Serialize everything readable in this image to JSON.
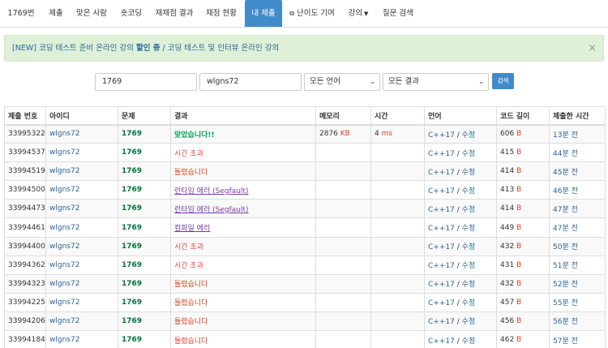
{
  "nav": {
    "tabs": [
      {
        "label": "1769번",
        "name": "tab-problem"
      },
      {
        "label": "제출",
        "name": "tab-submit"
      },
      {
        "label": "맞은 사람",
        "name": "tab-correct-users"
      },
      {
        "label": "숏코딩",
        "name": "tab-short-coding"
      },
      {
        "label": "재채점 결과",
        "name": "tab-rejudge-result"
      },
      {
        "label": "채점 현황",
        "name": "tab-status"
      },
      {
        "label": "내 제출",
        "name": "tab-my-submissions",
        "active": true
      },
      {
        "label": "난이도 기여",
        "name": "tab-difficulty"
      },
      {
        "label": "강의",
        "name": "tab-lectures"
      },
      {
        "label": "질문 검색",
        "name": "tab-question-search"
      }
    ]
  },
  "alert": {
    "new_tag": "[NEW]",
    "part1": "코딩 테스트 준비 온라인 강의",
    "bold1": "할인 중",
    "sep": "/",
    "part2": "코딩 테스트 및 인터뷰 온라인 강의",
    "close": "×"
  },
  "filters": {
    "problem_id": "1769",
    "user_id": "wlgns72",
    "language": "모든 언어",
    "result": "모든 결과",
    "search_button": "검색"
  },
  "table": {
    "headers": [
      "제출 번호",
      "아이디",
      "문제",
      "결과",
      "메모리",
      "시간",
      "언어",
      "코드 길이",
      "제출한 시간"
    ],
    "rows": [
      {
        "id": "33995322",
        "user": "wlgns72",
        "problem": "1769",
        "result": "맞았습니다!!",
        "type": "ok",
        "memory": "2876",
        "memory_unit": "KB",
        "time": "4",
        "time_unit": "ms",
        "lang": "C++17",
        "edit": "수정",
        "length": "606",
        "length_unit": "B",
        "submitted": "13분 전"
      },
      {
        "id": "33994537",
        "user": "wlgns72",
        "problem": "1769",
        "result": "시간 초과",
        "type": "tle",
        "memory": "",
        "memory_unit": "",
        "time": "",
        "time_unit": "",
        "lang": "C++17",
        "edit": "수정",
        "length": "415",
        "length_unit": "B",
        "submitted": "44분 전"
      },
      {
        "id": "33994519",
        "user": "wlgns72",
        "problem": "1769",
        "result": "틀렸습니다",
        "type": "wrong",
        "memory": "",
        "memory_unit": "",
        "time": "",
        "time_unit": "",
        "lang": "C++17",
        "edit": "수정",
        "length": "414",
        "length_unit": "B",
        "submitted": "45분 전"
      },
      {
        "id": "33994500",
        "user": "wlgns72",
        "problem": "1769",
        "result": "런타임 에러 (Segfault)",
        "type": "rte",
        "memory": "",
        "memory_unit": "",
        "time": "",
        "time_unit": "",
        "lang": "C++17",
        "edit": "수정",
        "length": "413",
        "length_unit": "B",
        "submitted": "46분 전"
      },
      {
        "id": "33994473",
        "user": "wlgns72",
        "problem": "1769",
        "result": "런타임 에러 (Segfault)",
        "type": "rte",
        "memory": "",
        "memory_unit": "",
        "time": "",
        "time_unit": "",
        "lang": "C++17",
        "edit": "수정",
        "length": "414",
        "length_unit": "B",
        "submitted": "47분 전"
      },
      {
        "id": "33994461",
        "user": "wlgns72",
        "problem": "1769",
        "result": "컴파일 에러",
        "type": "ce",
        "memory": "",
        "memory_unit": "",
        "time": "",
        "time_unit": "",
        "lang": "C++17",
        "edit": "수정",
        "length": "449",
        "length_unit": "B",
        "submitted": "47분 전"
      },
      {
        "id": "33994400",
        "user": "wlgns72",
        "problem": "1769",
        "result": "시간 초과",
        "type": "tle",
        "memory": "",
        "memory_unit": "",
        "time": "",
        "time_unit": "",
        "lang": "C++17",
        "edit": "수정",
        "length": "432",
        "length_unit": "B",
        "submitted": "50분 전"
      },
      {
        "id": "33994362",
        "user": "wlgns72",
        "problem": "1769",
        "result": "시간 초과",
        "type": "tle",
        "memory": "",
        "memory_unit": "",
        "time": "",
        "time_unit": "",
        "lang": "C++17",
        "edit": "수정",
        "length": "431",
        "length_unit": "B",
        "submitted": "51분 전"
      },
      {
        "id": "33994323",
        "user": "wlgns72",
        "problem": "1769",
        "result": "틀렸습니다",
        "type": "wrong",
        "memory": "",
        "memory_unit": "",
        "time": "",
        "time_unit": "",
        "lang": "C++17",
        "edit": "수정",
        "length": "432",
        "length_unit": "B",
        "submitted": "52분 전"
      },
      {
        "id": "33994225",
        "user": "wlgns72",
        "problem": "1769",
        "result": "틀렸습니다",
        "type": "wrong",
        "memory": "",
        "memory_unit": "",
        "time": "",
        "time_unit": "",
        "lang": "C++17",
        "edit": "수정",
        "length": "457",
        "length_unit": "B",
        "submitted": "55분 전"
      },
      {
        "id": "33994206",
        "user": "wlgns72",
        "problem": "1769",
        "result": "틀렸습니다",
        "type": "wrong",
        "memory": "",
        "memory_unit": "",
        "time": "",
        "time_unit": "",
        "lang": "C++17",
        "edit": "수정",
        "length": "456",
        "length_unit": "B",
        "submitted": "56분 전"
      },
      {
        "id": "33994184",
        "user": "wlgns72",
        "problem": "1769",
        "result": "틀렸습니다",
        "type": "wrong",
        "memory": "",
        "memory_unit": "",
        "time": "",
        "time_unit": "",
        "lang": "C++17",
        "edit": "수정",
        "length": "462",
        "length_unit": "B",
        "submitted": "57분 전"
      }
    ]
  },
  "colors": {
    "accent": "#428bca",
    "ok": "#00a65a",
    "wrong": "#dd4124",
    "alert_bg": "#dff0d8"
  }
}
